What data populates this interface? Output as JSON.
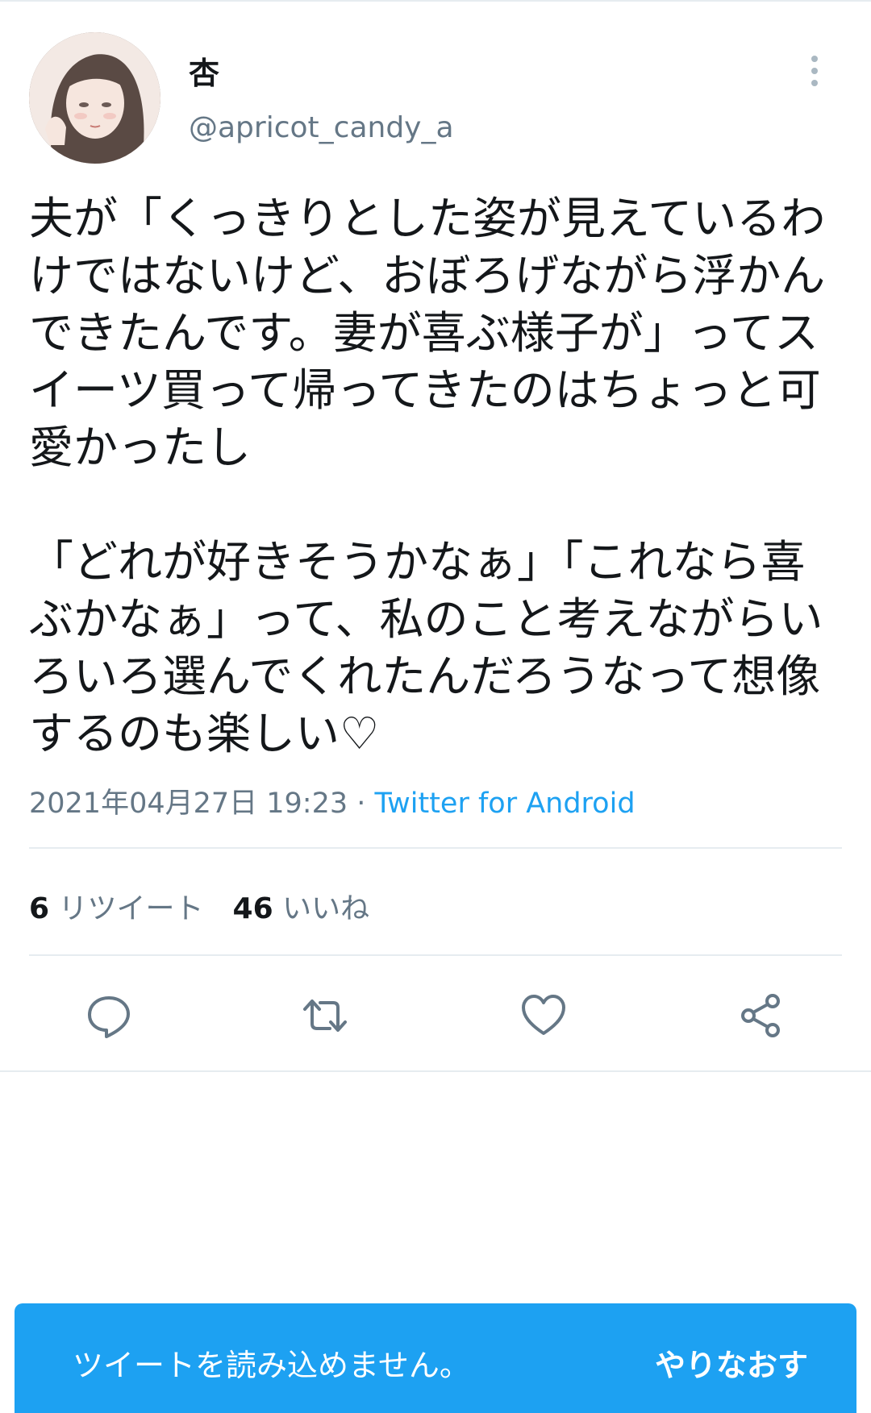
{
  "user": {
    "display_name": "杏",
    "handle": "@apricot_candy_a"
  },
  "tweet": {
    "text": "夫が「くっきりとした姿が見えているわけではないけど、おぼろげながら浮かんできたんです。妻が喜ぶ様子が」ってスイーツ買って帰ってきたのはちょっと可愛かったし\n\n「どれが好きそうかなぁ」「これなら喜ぶかなぁ」って、私のこと考えながらいろいろ選んでくれたんだろうなって想像するのも楽しい♡",
    "timestamp": "2021年04月27日 19:23",
    "separator": " · ",
    "source": "Twitter for Android"
  },
  "stats": {
    "retweet_count": "6",
    "retweet_label": "リツイート",
    "like_count": "46",
    "like_label": "いいね"
  },
  "actions": {
    "icons": [
      "reply-icon",
      "retweet-icon",
      "like-icon",
      "share-icon"
    ]
  },
  "snackbar": {
    "message": "ツイートを読み込めません。",
    "action": "やりなおす"
  },
  "colors": {
    "accent": "#1da1f2",
    "secondary_text": "#657786",
    "primary_text": "#14171a",
    "divider": "#e6ecf0"
  }
}
